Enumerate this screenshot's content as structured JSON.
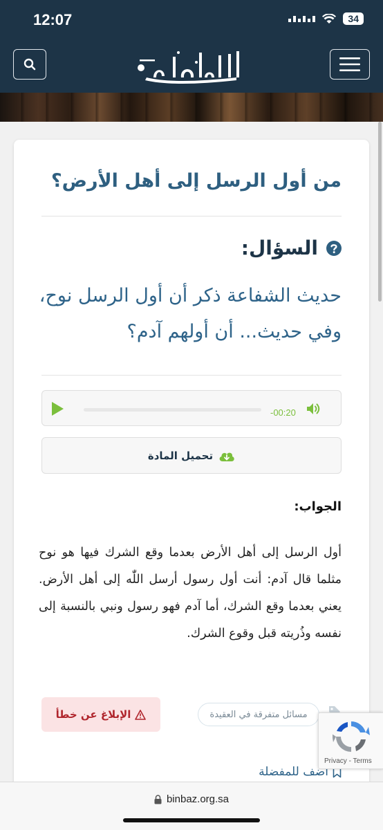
{
  "status_bar": {
    "time": "12:07",
    "battery": "34"
  },
  "header": {
    "logo_text": "الإمام ابن باز"
  },
  "question": {
    "title": "من أول الرسل إلى أهل الأرض؟",
    "label": "السؤال:",
    "text": "حديث الشفاعة ذكر أن أول الرسل نوح، وفي حديث... أن أولهم آدم؟"
  },
  "audio": {
    "time": "-00:20"
  },
  "download": {
    "label": "تحميل المادة"
  },
  "answer": {
    "label": "الجواب:",
    "text": "أول الرسل إلى أهل الأرض بعدما وقع الشرك فيها هو نوح مثلما قال آدم: أنت أول رسول أرسل اللّٰه إلى أهل الأرض. يعني بعدما وقع الشرك، أما آدم فهو رسول ونبي بالنسبة إلى نفسه وذُريته قبل وقوع الشرك."
  },
  "report": {
    "label": "الإبلاغ عن خطأ"
  },
  "tag": {
    "label": "مسائل متفرقة في العقيدة"
  },
  "favorite": {
    "label": "أضف للمفضلة"
  },
  "recaptcha": {
    "privacy": "Privacy",
    "separator": " - ",
    "terms": "Terms"
  },
  "browser": {
    "url": "binbaz.org.sa"
  },
  "colors": {
    "header": "#1d3447",
    "link": "#2e6389",
    "accent_green": "#7bbf3c",
    "error": "#b0262d"
  }
}
